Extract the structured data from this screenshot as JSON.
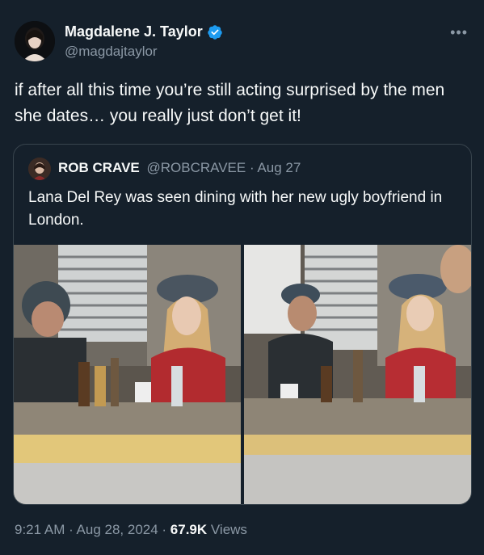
{
  "author": {
    "name": "Magdalene J. Taylor",
    "handle": "@magdajtaylor"
  },
  "tweet": {
    "text": "if after all this time you’re still acting surprised by the men she dates… you really just don’t get it!"
  },
  "quoted": {
    "name": "ROB CRAVE",
    "handle_date": "@ROBCRAVEE · Aug 27",
    "text": "Lana Del Rey was seen dining with her new ugly boyfriend in London."
  },
  "meta": {
    "time_date": "9:21 AM · Aug 28, 2024 · ",
    "views_count": "67.9K",
    "views_label": " Views"
  },
  "icons": {
    "more": "more-icon",
    "verified": "verified-badge-icon"
  },
  "colors": {
    "background": "#15202b",
    "secondary_text": "#8b98a5",
    "verified": "#1d9bf0",
    "border": "#38444d"
  }
}
